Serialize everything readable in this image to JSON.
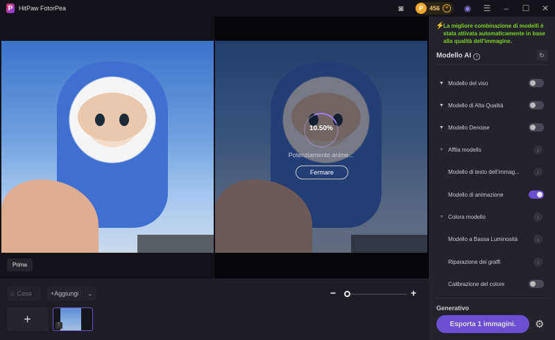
{
  "app": {
    "title": "HitPaw FotorPea",
    "logo_letter": "P"
  },
  "titlebar": {
    "coins": "456",
    "coin_letter": "P",
    "icons": [
      "discord-icon",
      "coin-icon",
      "add-coins-icon",
      "account-icon",
      "menu-icon",
      "minimize-icon",
      "maximize-icon",
      "close-icon"
    ]
  },
  "preview": {
    "before_label": "Prima",
    "progress_text": "10.50%",
    "progress_value": 10.5,
    "status": "Potenziamento anime...",
    "stop_label": "Fermare"
  },
  "bottom": {
    "home_label": "Casa",
    "add_label": "Aggiungi",
    "zoom_minus": "−",
    "zoom_plus": "+",
    "add_tile": "+"
  },
  "sidebar": {
    "tip": "La migliore combinazione di modelli è stata attivata automaticamente in base alla qualità dell'immagine.",
    "ai_title": "Modello AI",
    "items": [
      {
        "label": "Modello del viso",
        "control": "toggle",
        "on": false
      },
      {
        "label": "Modello di Alta Qualità",
        "control": "toggle",
        "on": false
      },
      {
        "label": "Modello Denoise",
        "control": "toggle",
        "on": false
      },
      {
        "label": "Affila modello",
        "control": "download"
      },
      {
        "label": "Modello di testo dell'immag...",
        "control": "download"
      },
      {
        "label": "Modello di animazione",
        "control": "toggle",
        "on": true
      },
      {
        "label": "Colora modello",
        "control": "download"
      },
      {
        "label": "Modello a Bassa Luminosità",
        "control": "download"
      },
      {
        "label": "Riparazione dei graffi",
        "control": "download"
      },
      {
        "label": "Calibrazione del colore",
        "control": "toggle",
        "on": false
      }
    ],
    "generative_title": "Generativo",
    "export_label": "Esporta 1 immagini."
  },
  "colors": {
    "accent": "#6a4fd0",
    "tip": "#7ed321",
    "coin": "#f0a830"
  }
}
